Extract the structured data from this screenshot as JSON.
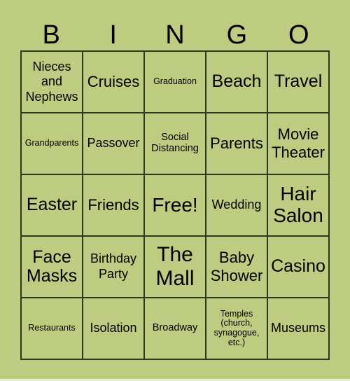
{
  "title_letters": [
    "B",
    "I",
    "N",
    "G",
    "O"
  ],
  "cells": [
    {
      "text": "Nieces and Nephews",
      "size": "s-m"
    },
    {
      "text": "Cruises",
      "size": "s-l"
    },
    {
      "text": "Graduation",
      "size": "s-xs"
    },
    {
      "text": "Beach",
      "size": "s-l2"
    },
    {
      "text": "Travel",
      "size": "s-l2"
    },
    {
      "text": "Grandparents",
      "size": "s-xs"
    },
    {
      "text": "Passover",
      "size": "s-m"
    },
    {
      "text": "Social Distancing",
      "size": "s-s"
    },
    {
      "text": "Parents",
      "size": "s-l"
    },
    {
      "text": "Movie Theater",
      "size": "s-l"
    },
    {
      "text": "Easter",
      "size": "s-l2"
    },
    {
      "text": "Friends",
      "size": "s-l"
    },
    {
      "text": "Free!",
      "size": "s-xl"
    },
    {
      "text": "Wedding",
      "size": "s-m"
    },
    {
      "text": "Hair Salon",
      "size": "s-xl"
    },
    {
      "text": "Face Masks",
      "size": "s-l2"
    },
    {
      "text": "Birthday Party",
      "size": "s-m"
    },
    {
      "text": "The Mall",
      "size": "s-xxl"
    },
    {
      "text": "Baby Shower",
      "size": "s-l"
    },
    {
      "text": "Casino",
      "size": "s-l2"
    },
    {
      "text": "Restaurants",
      "size": "s-xs"
    },
    {
      "text": "Isolation",
      "size": "s-m"
    },
    {
      "text": "Broadway",
      "size": "s-s"
    },
    {
      "text": "Temples (church, synagogue, etc.)",
      "size": "s-xs"
    },
    {
      "text": "Museums",
      "size": "s-m"
    }
  ]
}
